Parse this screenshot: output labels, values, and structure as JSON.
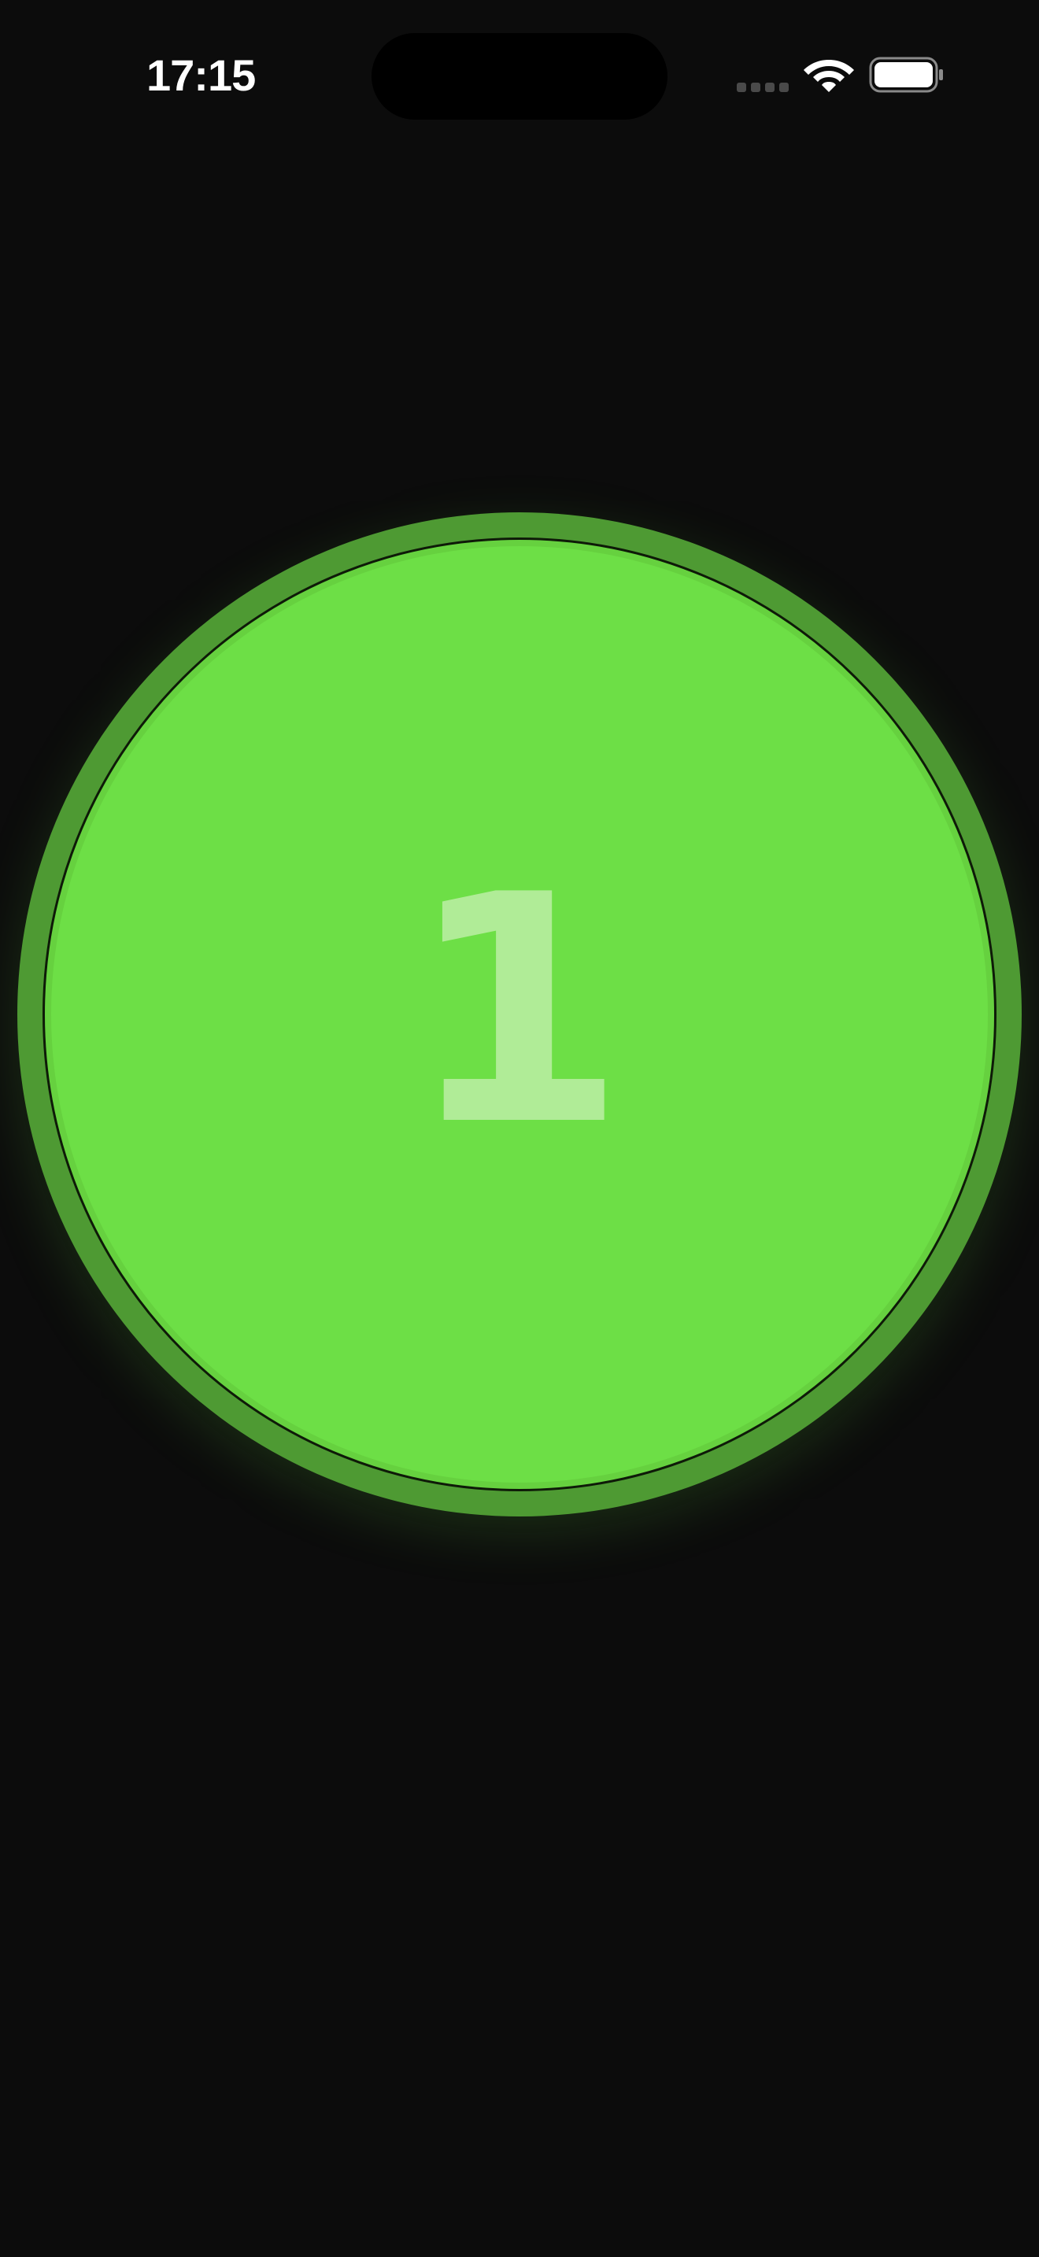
{
  "status_bar": {
    "time": "17:15",
    "icons": {
      "signal": "cellular-signal-icon",
      "wifi": "wifi-icon",
      "battery": "battery-icon"
    }
  },
  "counter": {
    "value": "1",
    "colors": {
      "background": "#0c0c0c",
      "ring": "#4e9a33",
      "fill": "#6ddf46",
      "digit": "#b0ec97"
    }
  }
}
